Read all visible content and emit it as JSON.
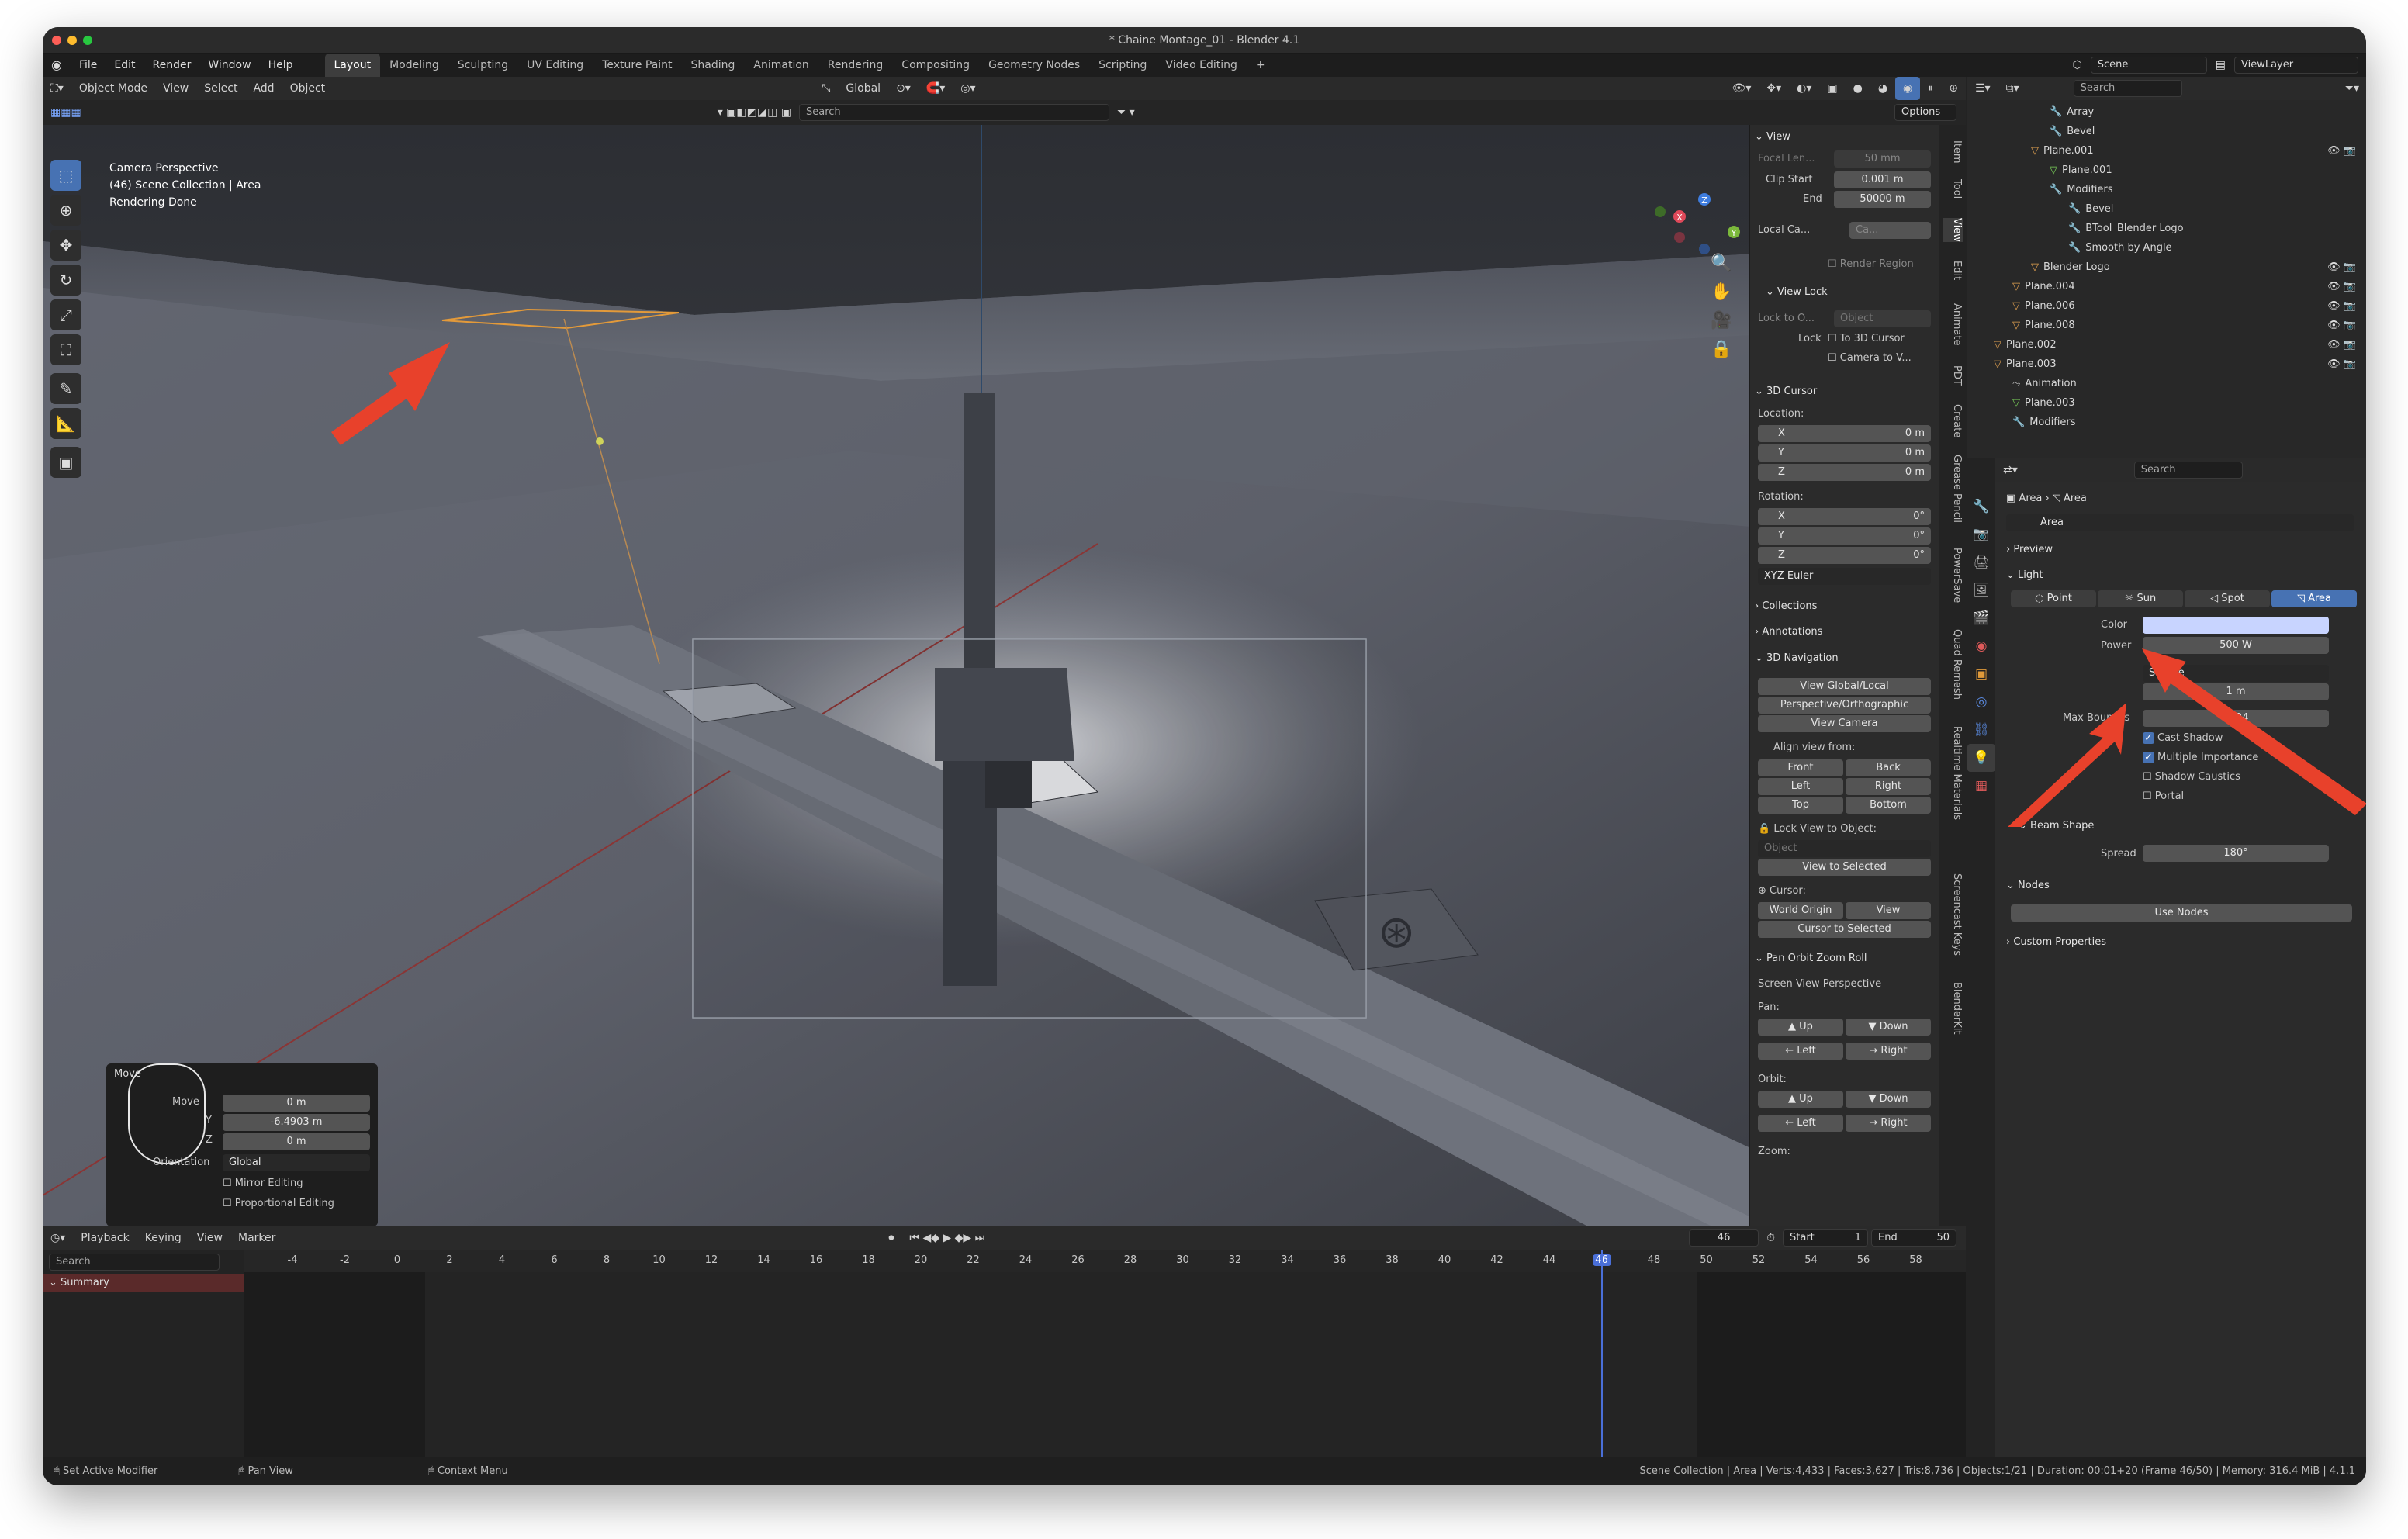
{
  "window": {
    "title": "* Chaine Montage_01 - Blender 4.1"
  },
  "menu": {
    "items": [
      "File",
      "Edit",
      "Render",
      "Window",
      "Help"
    ]
  },
  "workspaces": [
    "Layout",
    "Modeling",
    "Sculpting",
    "UV Editing",
    "Texture Paint",
    "Shading",
    "Animation",
    "Rendering",
    "Compositing",
    "Geometry Nodes",
    "Scripting",
    "Video Editing"
  ],
  "workspace_add": "+",
  "scene": {
    "name": "Scene",
    "viewlayer": "ViewLayer"
  },
  "vp_header": {
    "mode": "Object Mode",
    "view": "View",
    "select": "Select",
    "add": "Add",
    "object": "Object",
    "orientation": "Global",
    "search_placeholder": "Search",
    "options": "Options"
  },
  "overlay_text": {
    "line1": "Camera Perspective",
    "line2": "(46) Scene Collection | Area",
    "line3": "Rendering Done"
  },
  "npanel": {
    "view_header": "View",
    "focal_label": "Focal Len...",
    "focal_value": "50 mm",
    "clip_start_label": "Clip Start",
    "clip_start": "0.001 m",
    "end_label": "End",
    "clip_end": "50000 m",
    "local_cam_label": "Local Ca...",
    "local_cam_value": "Ca...",
    "render_region": "Render Region",
    "view_lock_header": "View Lock",
    "lock_to_label": "Lock to O...",
    "lock_to_value": "Object",
    "lock_label": "Lock",
    "to_3d_cursor": "To 3D Cursor",
    "camera_to_view": "Camera to V...",
    "cursor_header": "3D Cursor",
    "location_label": "Location:",
    "x_label": "X",
    "y_label": "Y",
    "z_label": "Z",
    "loc_x": "0 m",
    "loc_y": "0 m",
    "loc_z": "0 m",
    "rotation_label": "Rotation:",
    "rot_x": "0°",
    "rot_y": "0°",
    "rot_z": "0°",
    "rot_mode": "XYZ Euler",
    "collections": "Collections",
    "annotations": "Annotations",
    "nav_header": "3D Navigation",
    "view_global_local": "View Global/Local",
    "persp_ortho": "Perspective/Orthographic",
    "view_camera": "View Camera",
    "align_view": "Align view from:",
    "front": "Front",
    "back": "Back",
    "left": "Left",
    "right": "Right",
    "top": "Top",
    "bottom": "Bottom",
    "lock_view_obj": "Lock View to Object:",
    "object_placeholder": "Object",
    "view_to_selected": "View to Selected",
    "cursor_label": "Cursor:",
    "world_origin": "World Origin",
    "view_btn": "View",
    "cursor_to_selected": "Cursor to Selected",
    "poz_header": "Pan Orbit Zoom Roll",
    "screen_view_persp": "Screen View Perspective",
    "pan_label": "Pan:",
    "up": "Up",
    "down": "Down",
    "orbit_label": "Orbit:",
    "zoom_label": "Zoom:"
  },
  "ntabs": [
    "Item",
    "Tool",
    "View",
    "Edit",
    "Animate",
    "PDT",
    "Create",
    "Grease Pencil",
    "PowerSave",
    "Quad Remesh",
    "Realtime Materials",
    "Screencast Keys",
    "BlenderKit"
  ],
  "move_panel": {
    "title": "Move",
    "move_label": "Move",
    "x": "0 m",
    "y": "-6.4903 m",
    "z": "0 m",
    "orientation_label": "Orientation",
    "orientation": "Global",
    "mirror": "Mirror Editing",
    "proportional": "Proportional Editing",
    "y_axis": "Y",
    "z_axis": "Z"
  },
  "outliner": {
    "search": "Search",
    "rows": [
      {
        "label": "Array",
        "indent": 4,
        "type": "mod"
      },
      {
        "label": "Bevel",
        "indent": 4,
        "type": "mod"
      },
      {
        "label": "Plane.001",
        "indent": 3,
        "type": "obj"
      },
      {
        "label": "Plane.001",
        "indent": 4,
        "type": "mesh"
      },
      {
        "label": "Modifiers",
        "indent": 4,
        "type": "mod"
      },
      {
        "label": "Bevel",
        "indent": 5,
        "type": "mod"
      },
      {
        "label": "BTool_Blender Logo",
        "indent": 5,
        "type": "mod"
      },
      {
        "label": "Smooth by Angle",
        "indent": 5,
        "type": "mod"
      },
      {
        "label": "Blender Logo",
        "indent": 3,
        "type": "obj"
      },
      {
        "label": "Plane.004",
        "indent": 2,
        "type": "obj"
      },
      {
        "label": "Plane.006",
        "indent": 2,
        "type": "obj"
      },
      {
        "label": "Plane.008",
        "indent": 2,
        "type": "obj"
      },
      {
        "label": "Plane.002",
        "indent": 1,
        "type": "obj"
      },
      {
        "label": "Plane.003",
        "indent": 1,
        "type": "obj"
      },
      {
        "label": "Animation",
        "indent": 2,
        "type": "anim"
      },
      {
        "label": "Plane.003",
        "indent": 2,
        "type": "mesh"
      },
      {
        "label": "Modifiers",
        "indent": 2,
        "type": "mod"
      }
    ]
  },
  "properties": {
    "search": "Search",
    "breadcrumb_1": "Area",
    "breadcrumb_2": "Area",
    "data_name": "Area",
    "preview": "Preview",
    "light": "Light",
    "types": [
      "Point",
      "Sun",
      "Spot",
      "Area"
    ],
    "color_label": "Color",
    "color_value": "#c8d4ff",
    "power_label": "Power",
    "power": "500 W",
    "shape": "Square",
    "size": "1 m",
    "max_bounces_label": "Max Bounces",
    "max_bounces": "1024",
    "cast_shadow": "Cast Shadow",
    "multiple_importance": "Multiple Importance",
    "shadow_caustics": "Shadow Caustics",
    "portal": "Portal",
    "beam_shape": "Beam Shape",
    "spread_label": "Spread",
    "spread": "180°",
    "nodes": "Nodes",
    "use_nodes": "Use Nodes",
    "custom_props": "Custom Properties"
  },
  "timeline": {
    "playback": "Playback",
    "keying": "Keying",
    "view": "View",
    "marker": "Marker",
    "current": "46",
    "start_label": "Start",
    "start": "1",
    "end_label": "End",
    "end": "50",
    "search": "Search",
    "summary": "Summary",
    "ticks": [
      "-4",
      "-2",
      "0",
      "2",
      "4",
      "6",
      "8",
      "10",
      "12",
      "14",
      "16",
      "18",
      "20",
      "22",
      "24",
      "26",
      "28",
      "30",
      "32",
      "34",
      "36",
      "38",
      "40",
      "42",
      "44",
      "46",
      "48",
      "50",
      "52",
      "54",
      "56",
      "58"
    ]
  },
  "status": {
    "left1": "Set Active Modifier",
    "left2": "Pan View",
    "left3": "Context Menu",
    "right": "Scene Collection | Area | Verts:4,433 | Faces:3,627 | Tris:8,736 | Objects:1/21 | Duration: 00:01+20 (Frame 46/50) | Memory: 316.4 MiB | 4.1.1"
  },
  "colors": {
    "accent": "#4772b3",
    "arrow": "#e8412b",
    "frame_line": "#4a6fd8"
  }
}
